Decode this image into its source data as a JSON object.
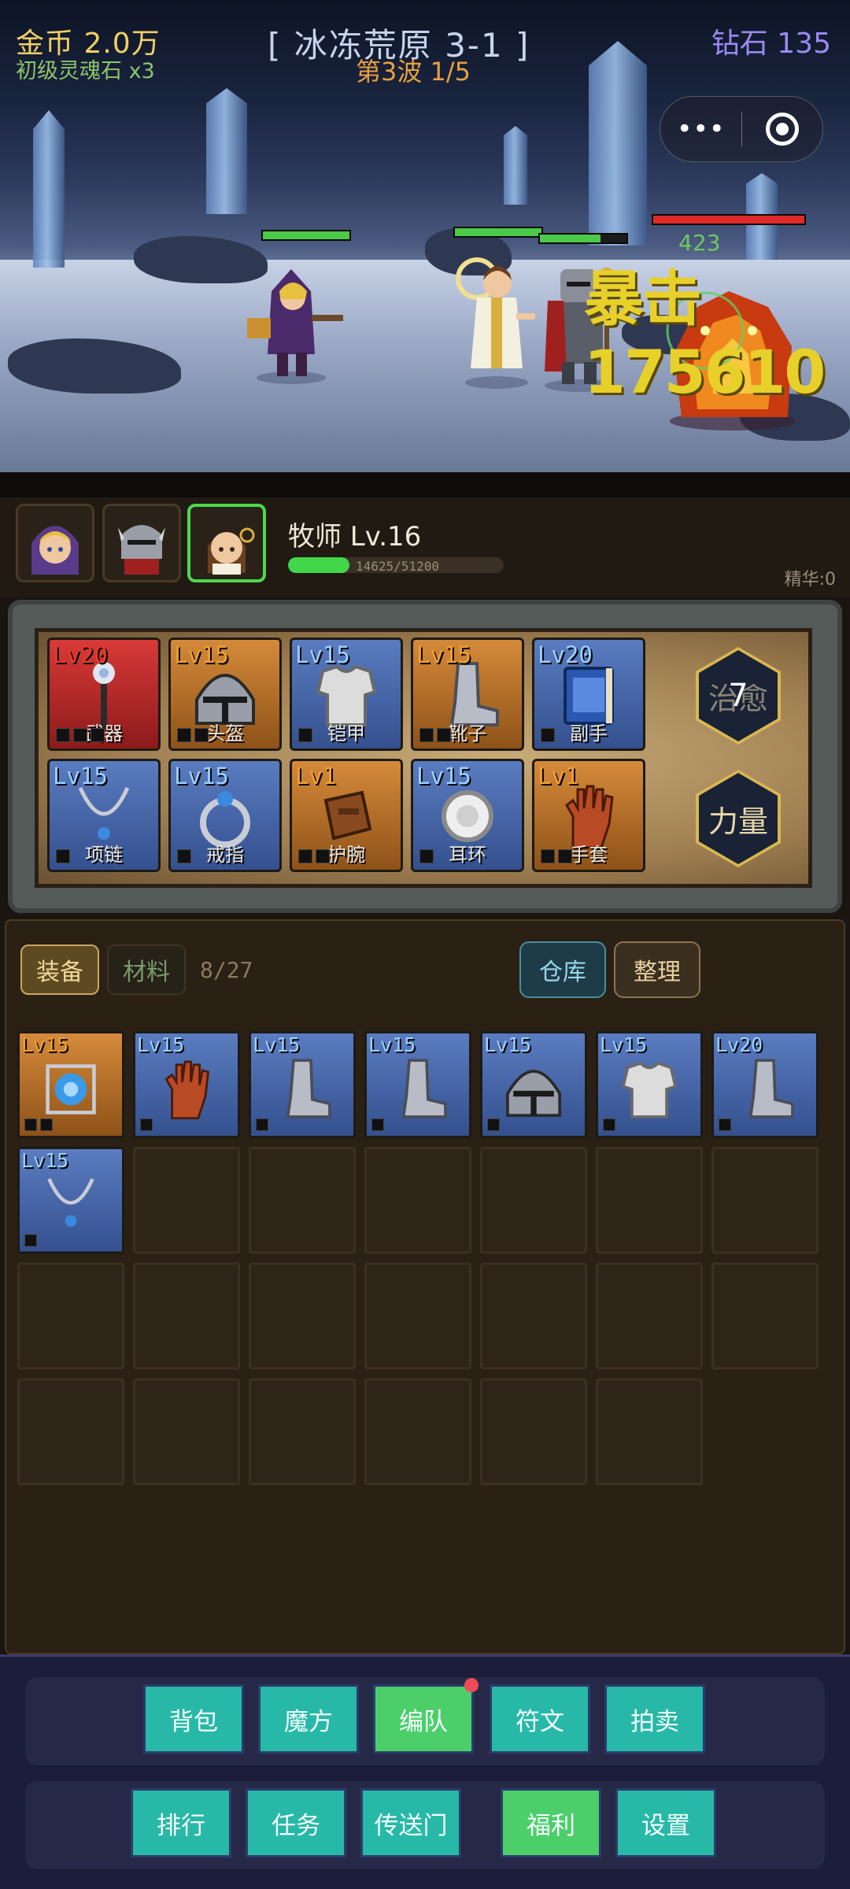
{
  "hud": {
    "gold": "金币 2.0万",
    "soul_stone": "初级灵魂石 x3",
    "stage": "[ 冰冻荒原 3-1 ]",
    "wave": "第3波 1/5",
    "diamond": "钻石 135"
  },
  "battle": {
    "damage_text": "暴击175610",
    "small_damage": "423",
    "units": [
      {
        "name": "mage",
        "hp": 1.0
      },
      {
        "name": "priest",
        "hp": 1.0
      },
      {
        "name": "knight",
        "hp": 0.7
      },
      {
        "name": "fire-demon",
        "hp": 1.0
      }
    ]
  },
  "hero": {
    "name": "牧师 Lv.16",
    "xp_current": 14625,
    "xp_max": 51200,
    "xp_text": "14625/51200",
    "essence": "精华:0",
    "portraits": [
      "mage-portrait",
      "knight-portrait",
      "priest-portrait"
    ],
    "active_portrait": 2
  },
  "equipment": {
    "slots": [
      {
        "level": "Lv20",
        "name": "武器",
        "rarity": "red",
        "pips": 3,
        "icon": "staff-icon"
      },
      {
        "level": "Lv15",
        "name": "头盔",
        "rarity": "orange",
        "pips": 2,
        "icon": "helmet-icon"
      },
      {
        "level": "Lv15",
        "name": "铠甲",
        "rarity": "blue",
        "pips": 1,
        "icon": "armor-icon"
      },
      {
        "level": "Lv15",
        "name": "靴子",
        "rarity": "orange",
        "pips": 2,
        "icon": "boots-icon"
      },
      {
        "level": "Lv20",
        "name": "副手",
        "rarity": "blue",
        "pips": 1,
        "icon": "spellbook-icon"
      },
      {
        "level": "Lv15",
        "name": "项链",
        "rarity": "blue",
        "pips": 1,
        "icon": "necklace-icon"
      },
      {
        "level": "Lv15",
        "name": "戒指",
        "rarity": "blue",
        "pips": 1,
        "icon": "ring-icon"
      },
      {
        "level": "Lv1",
        "name": "护腕",
        "rarity": "orange",
        "pips": 2,
        "icon": "bracer-icon"
      },
      {
        "level": "Lv15",
        "name": "耳环",
        "rarity": "blue",
        "pips": 1,
        "icon": "earring-icon"
      },
      {
        "level": "Lv1",
        "name": "手套",
        "rarity": "orange",
        "pips": 2,
        "icon": "glove-icon"
      }
    ],
    "skill_heal": "治愈",
    "skill_heal_badge": "7",
    "skill_strength": "力量"
  },
  "inventory": {
    "tab_equipment": "装备",
    "tab_material": "材料",
    "count": "8/27",
    "warehouse": "仓库",
    "sort": "整理",
    "items": [
      {
        "level": "Lv15",
        "rarity": "orange",
        "icon": "rune-cube-icon",
        "pips": 2
      },
      {
        "level": "Lv15",
        "rarity": "blue",
        "icon": "glove-icon",
        "pips": 1
      },
      {
        "level": "Lv15",
        "rarity": "blue",
        "icon": "boots-icon",
        "pips": 1
      },
      {
        "level": "Lv15",
        "rarity": "blue",
        "icon": "boots-icon",
        "pips": 1
      },
      {
        "level": "Lv15",
        "rarity": "blue",
        "icon": "helmet-icon",
        "pips": 1
      },
      {
        "level": "Lv15",
        "rarity": "blue",
        "icon": "armor-icon",
        "pips": 1
      },
      {
        "level": "Lv20",
        "rarity": "blue",
        "icon": "boots-icon",
        "pips": 1
      },
      {
        "level": "Lv15",
        "rarity": "blue",
        "icon": "necklace-icon",
        "pips": 1
      }
    ],
    "capacity": 27
  },
  "menu": {
    "row1": [
      {
        "label": "背包",
        "style": "teal"
      },
      {
        "label": "魔方",
        "style": "teal"
      },
      {
        "label": "编队",
        "style": "green",
        "notification": true
      },
      {
        "label": "符文",
        "style": "teal"
      },
      {
        "label": "拍卖",
        "style": "teal"
      }
    ],
    "row2": [
      {
        "label": "排行",
        "style": "teal"
      },
      {
        "label": "任务",
        "style": "teal"
      },
      {
        "label": "传送门",
        "style": "teal"
      },
      {
        "label": "福利",
        "style": "green"
      },
      {
        "label": "设置",
        "style": "teal"
      }
    ]
  },
  "colors": {
    "teal_button": "#28b8a8",
    "green_button": "#4ccf6a",
    "xp_green": "#42d64a",
    "gold_text": "#f2d064",
    "diamond_text": "#9a8af0"
  }
}
